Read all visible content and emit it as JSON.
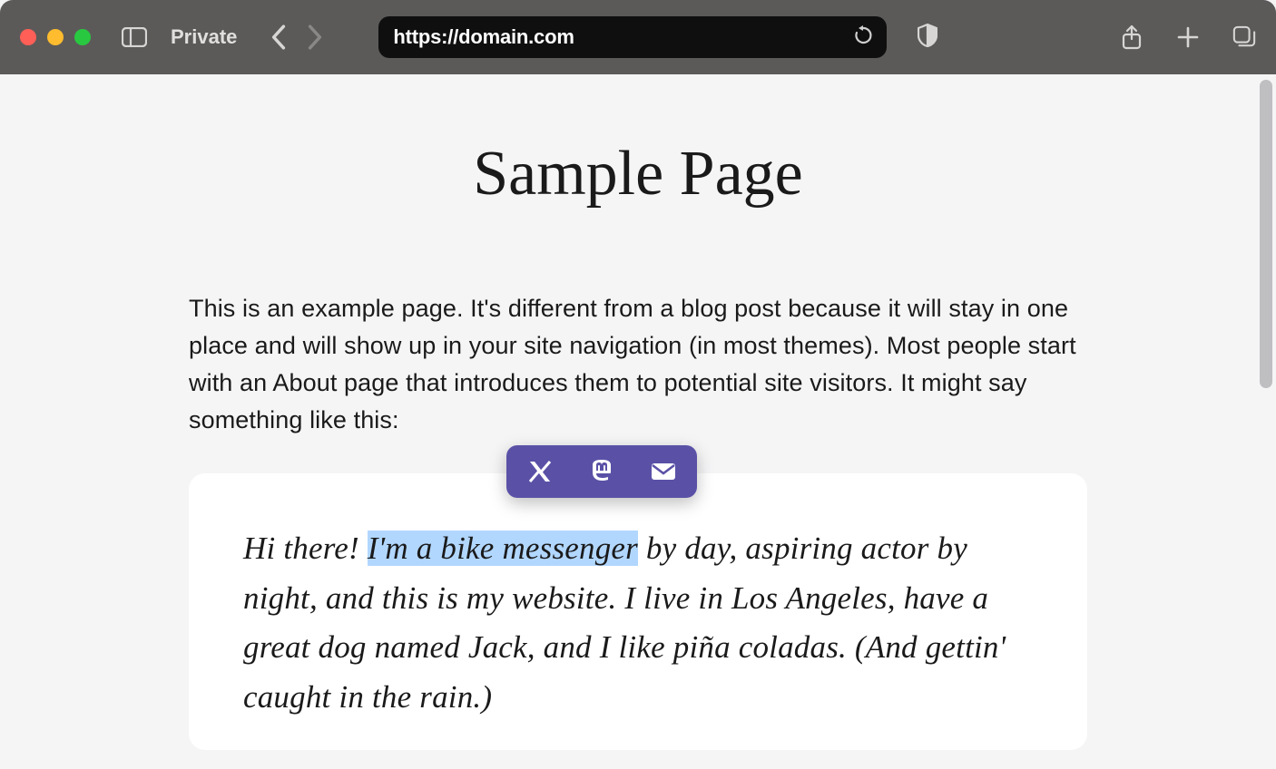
{
  "browser": {
    "private_label": "Private",
    "url": "https://domain.com"
  },
  "page": {
    "title": "Sample Page",
    "intro": "This is an example page. It's different from a blog post because it will stay in one place and will show up in your site navigation (in most themes). Most people start with an About page that introduces them to potential site visitors. It might say something like this:",
    "quote": {
      "before_highlight": "Hi there! ",
      "highlight": "I'm a bike messenger",
      "after_highlight": " by day, aspiring actor by night, and this is my website. I live in Los Angeles, have a great dog named Jack, and I like piña coladas. (And gettin' caught in the rain.)"
    }
  },
  "share": {
    "options": [
      "x-twitter",
      "mastodon",
      "email"
    ]
  }
}
